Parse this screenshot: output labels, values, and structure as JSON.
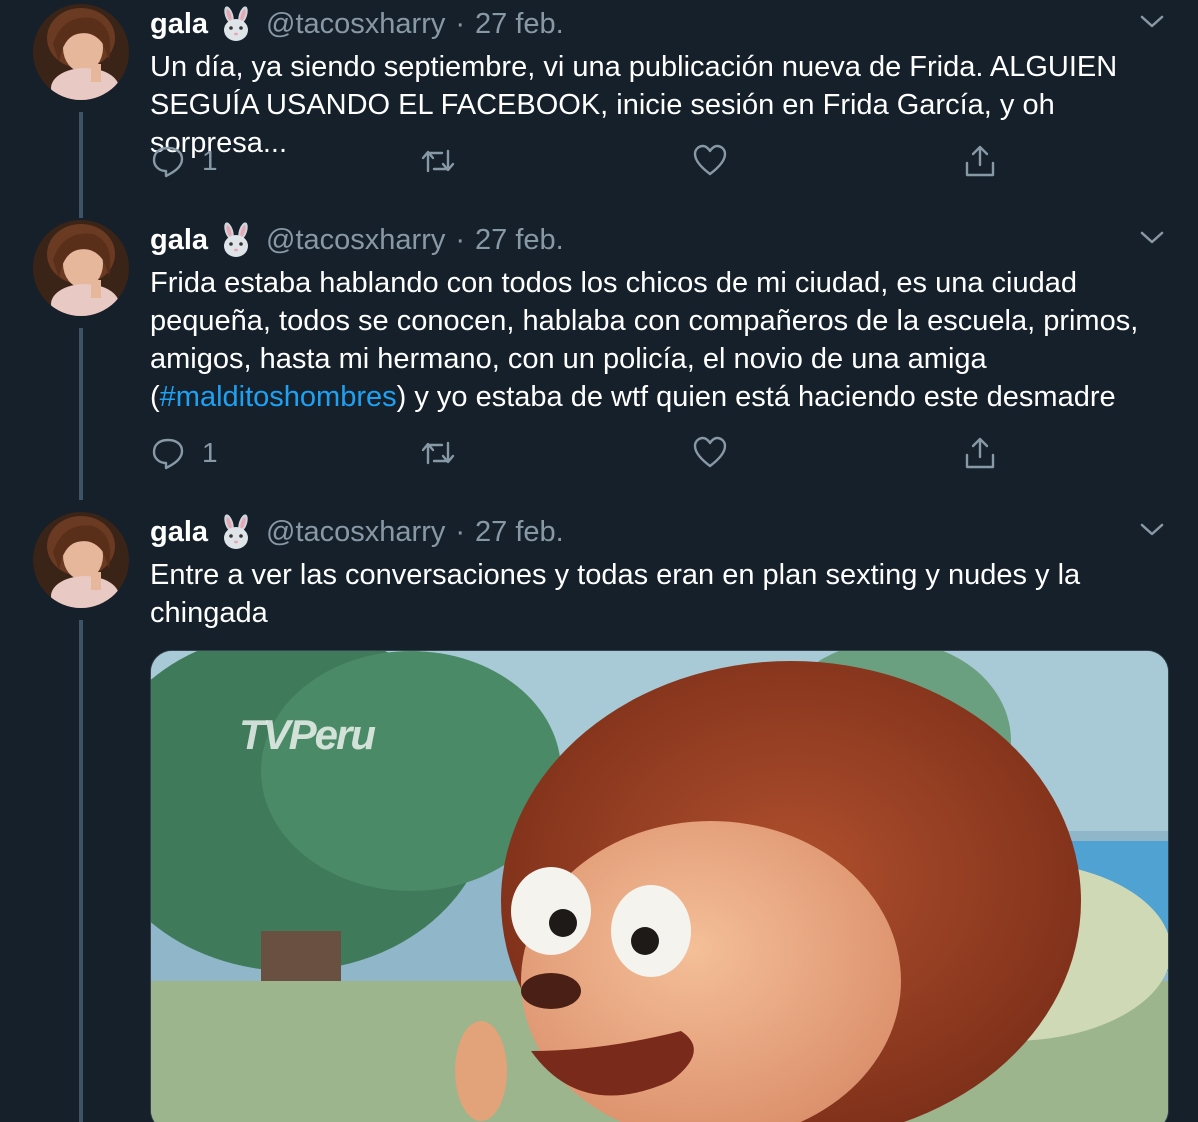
{
  "tweets": [
    {
      "name": "gala",
      "emoji": "rabbit-face-emoji",
      "handle": "@tacosxharry",
      "sep": "·",
      "date": "27 feb.",
      "text": "Un día, ya siendo septiembre, vi una publicación nueva de Frida. ALGUIEN SEGUÍA USANDO EL FACEBOOK, inicie sesión en Frida García, y oh sorpresa...",
      "reply_count": "1",
      "retweet_count": "",
      "like_count": ""
    },
    {
      "name": "gala",
      "emoji": "rabbit-face-emoji",
      "handle": "@tacosxharry",
      "sep": "·",
      "date": "27 feb.",
      "text_before": "Frida estaba hablando con todos los chicos de mi ciudad, es una ciudad pequeña, todos se conocen, hablaba con compañeros de la escuela, primos, amigos, hasta mi hermano, con un policía, el novio de una amiga (",
      "hashtag": "#malditoshombres",
      "text_after": ") y yo estaba de wtf quien está haciendo este desmadre",
      "reply_count": "1",
      "retweet_count": "",
      "like_count": ""
    },
    {
      "name": "gala",
      "emoji": "rabbit-face-emoji",
      "handle": "@tacosxharry",
      "sep": "·",
      "date": "27 feb.",
      "text": "Entre a ver las conversaciones y todas eran en plan sexting y nudes y la chingada",
      "media": {
        "watermark": "TVPeru",
        "subject": "surprised-monkey-puppet-gif"
      }
    }
  ],
  "colors": {
    "background": "#15202b",
    "text": "#ffffff",
    "secondary": "#8899a6",
    "hashtag": "#1da1f2",
    "thread_line": "#3d5466"
  }
}
